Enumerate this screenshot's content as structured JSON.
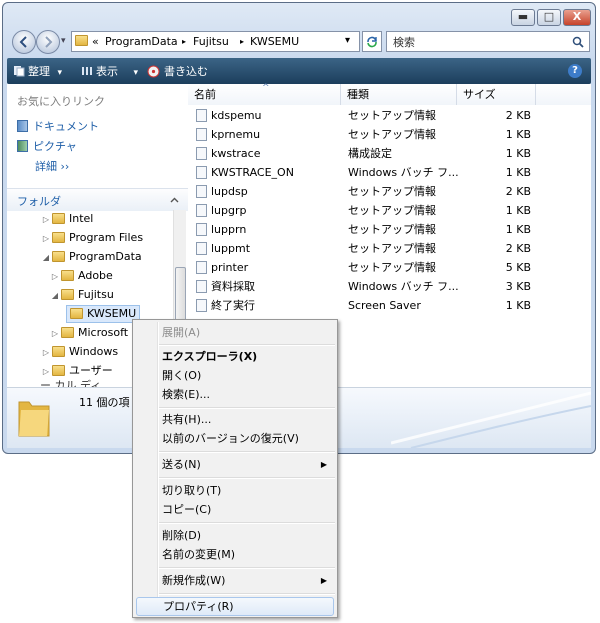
{
  "colors": {
    "accent": "#1f5fa8",
    "toolbar": "#2a4d6e",
    "selection": "#d9e8fb"
  },
  "window": {
    "caption_buttons": {
      "minimize": "▬",
      "maximize": "□",
      "close": "X"
    }
  },
  "address_bar": {
    "chevron": "«",
    "segments": [
      "ProgramData",
      "Fujitsu",
      "KWSEMU"
    ],
    "separator": "▸",
    "dropdown": "▾"
  },
  "search": {
    "placeholder": "検索",
    "icon": "search-icon"
  },
  "toolbar": {
    "organize": "整理",
    "views": "表示",
    "burn": "書き込む",
    "dropdown": "▾",
    "help": "?"
  },
  "left_panel": {
    "favorites_header": "お気に入りリンク",
    "favorites": [
      {
        "label": "ドキュメント",
        "icon": "documents-icon"
      },
      {
        "label": "ピクチャ",
        "icon": "pictures-icon"
      },
      {
        "label": "詳細 ››",
        "icon": ""
      }
    ],
    "folders_header": "フォルダ",
    "tree": [
      {
        "label": "Intel",
        "expander": "▷"
      },
      {
        "label": "Program Files",
        "expander": "▷"
      },
      {
        "label": "ProgramData",
        "expander": "◢"
      },
      {
        "label": "Adobe",
        "expander": "▷"
      },
      {
        "label": "Fujitsu",
        "expander": "◢"
      },
      {
        "label": "KWSEMU",
        "expander": ""
      },
      {
        "label": "Microsoft",
        "expander": "▷"
      },
      {
        "label": "Windows",
        "expander": "▷"
      },
      {
        "label": "ユーザー",
        "expander": "▷"
      }
    ],
    "tree_partial": "ー カル ディ"
  },
  "file_list": {
    "columns": [
      "名前",
      "種類",
      "サイズ"
    ],
    "sort_indicator": "^",
    "rows": [
      {
        "name": "kdspemu",
        "type": "セットアップ情報",
        "size": "2 KB"
      },
      {
        "name": "kprnemu",
        "type": "セットアップ情報",
        "size": "1 KB"
      },
      {
        "name": "kwstrace",
        "type": "構成設定",
        "size": "1 KB"
      },
      {
        "name": "KWSTRACE_ON",
        "type": "Windows バッチ フ...",
        "size": "1 KB"
      },
      {
        "name": "lupdsp",
        "type": "セットアップ情報",
        "size": "2 KB"
      },
      {
        "name": "lupgrp",
        "type": "セットアップ情報",
        "size": "1 KB"
      },
      {
        "name": "lupprn",
        "type": "セットアップ情報",
        "size": "1 KB"
      },
      {
        "name": "luppmt",
        "type": "セットアップ情報",
        "size": "2 KB"
      },
      {
        "name": "printer",
        "type": "セットアップ情報",
        "size": "5 KB"
      },
      {
        "name": "資料採取",
        "type": "Windows バッチ フ...",
        "size": "3 KB"
      },
      {
        "name": "終了実行",
        "type": "Screen Saver",
        "size": "1 KB"
      }
    ]
  },
  "details_pane": {
    "item_count": "11 個の項"
  },
  "context_menu": {
    "items": [
      {
        "label": "展開(A)",
        "disabled": true,
        "bold": false,
        "submenu": false
      },
      {
        "label": "エクスプローラ(X)",
        "disabled": false,
        "bold": true,
        "submenu": false
      },
      {
        "label": "開く(O)",
        "disabled": false,
        "bold": false,
        "submenu": false
      },
      {
        "label": "検索(E)...",
        "disabled": false,
        "bold": false,
        "submenu": false
      },
      {
        "label": "共有(H)...",
        "disabled": false,
        "bold": false,
        "submenu": false
      },
      {
        "label": "以前のバージョンの復元(V)",
        "disabled": false,
        "bold": false,
        "submenu": false
      },
      {
        "label": "送る(N)",
        "disabled": false,
        "bold": false,
        "submenu": true
      },
      {
        "label": "切り取り(T)",
        "disabled": false,
        "bold": false,
        "submenu": false
      },
      {
        "label": "コピー(C)",
        "disabled": false,
        "bold": false,
        "submenu": false
      },
      {
        "label": "削除(D)",
        "disabled": false,
        "bold": false,
        "submenu": false
      },
      {
        "label": "名前の変更(M)",
        "disabled": false,
        "bold": false,
        "submenu": false
      },
      {
        "label": "新規作成(W)",
        "disabled": false,
        "bold": false,
        "submenu": true
      },
      {
        "label": "プロパティ(R)",
        "disabled": false,
        "bold": false,
        "submenu": false,
        "highlighted": true
      }
    ],
    "submenu_arrow": "▶"
  }
}
